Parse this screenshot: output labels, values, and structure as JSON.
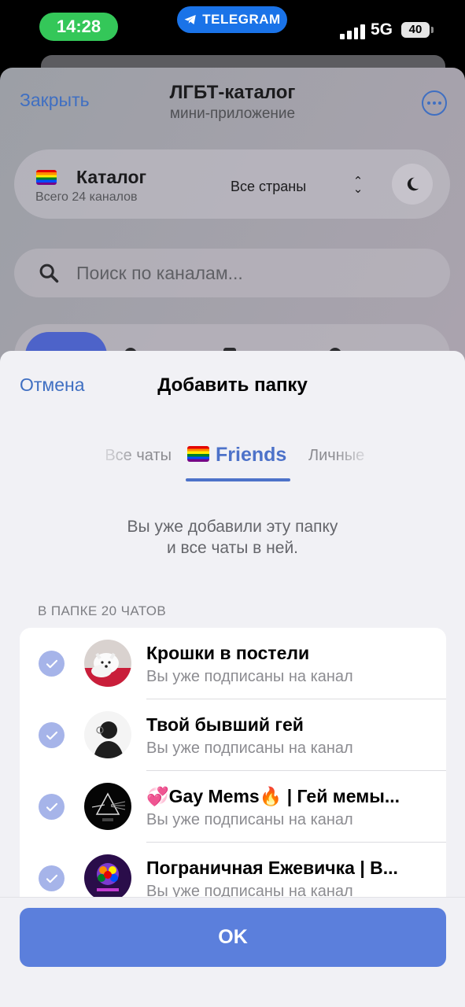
{
  "status_bar": {
    "time": "14:28",
    "indicator_label": "TELEGRAM",
    "network": "5G",
    "battery": "40"
  },
  "app": {
    "close_label": "Закрыть",
    "title": "ЛГБТ-каталог",
    "subtitle": "мини-приложение",
    "catalog": {
      "title": "Каталог",
      "count": "Всего 24 каналов",
      "country_select": "Все страны"
    },
    "search_placeholder": "Поиск по каналам..."
  },
  "sheet": {
    "cancel_label": "Отмена",
    "title": "Добавить папку",
    "tabs": [
      {
        "label": "Все чаты",
        "active": false
      },
      {
        "label": "Friends",
        "active": true
      },
      {
        "label": "Личные",
        "active": false
      }
    ],
    "notice_line1": "Вы уже добавили эту папку",
    "notice_line2": "и все чаты в ней.",
    "section_header": "В ПАПКЕ 20 ЧАТОВ",
    "chats": [
      {
        "name": "Крошки в постели",
        "status": "Вы уже подписаны на канал",
        "checked": true,
        "avatar": "samoyed-dog-avatar"
      },
      {
        "name": "Твой бывший гей",
        "status": "Вы уже подписаны на канал",
        "checked": true,
        "avatar": "dark-silhouette-avatar"
      },
      {
        "name": "💞Gay Mems🔥 | Гей мемы...",
        "status": "Вы уже подписаны на канал",
        "checked": true,
        "avatar": "prism-triangle-avatar"
      },
      {
        "name": "Пограничная Ежевичка | В...",
        "status": "Вы уже подписаны на канал",
        "checked": true,
        "avatar": "rainbow-brain-avatar"
      }
    ],
    "ok_label": "OK"
  },
  "colors": {
    "accent": "#4d72c9",
    "ok_button": "#5b7fdc",
    "checkbox": "#a6b4e9",
    "time_pill": "#34c759",
    "telegram_pill": "#1a73e8"
  }
}
